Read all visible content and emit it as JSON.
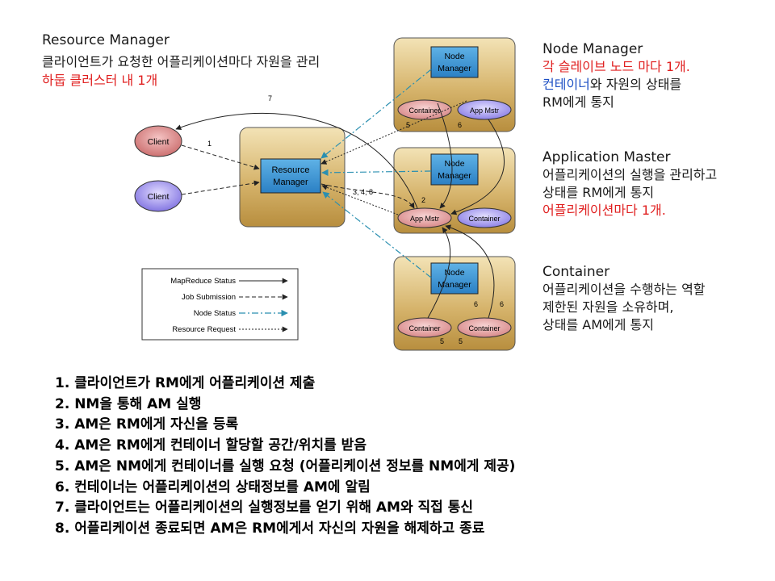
{
  "rm_desc": {
    "title": "Resource Manager",
    "line1": "클라이언트가 요청한 어플리케이션마다  자원을 관리",
    "line2": "하둡 클러스터 내 1개"
  },
  "nm_desc": {
    "title": "Node Manager",
    "line1": "각 슬레이브 노드 마다 1개.",
    "line2_blue": "컨테이너",
    "line2_rest": "와 자원의 상태를",
    "line3": "RM에게 통지"
  },
  "am_desc": {
    "title": "Application Master",
    "line1": "어플리케이션의 실행을 관리하고",
    "line2": "상태를 RM에게 통지",
    "line3": "어플리케이션마다 1개."
  },
  "container_desc": {
    "title": "Container",
    "line1": "어플리케이션을 수행하는 역할",
    "line2": "제한된 자원을 소유하며,",
    "line3": "상태를 AM에게 통지"
  },
  "diagram": {
    "client_label": "Client",
    "rm_label_1": "Resource",
    "rm_label_2": "Manager",
    "nm_label_1": "Node",
    "nm_label_2": "Manager",
    "container_label": "Container",
    "appmstr_label": "App Mstr",
    "num_7": "7",
    "num_1": "1",
    "num_2": "2",
    "num_348": "3, 4, 8",
    "num_5": "5",
    "num_6": "6",
    "legend": {
      "mapreduce": "MapReduce Status",
      "job": "Job Submission",
      "node": "Node Status",
      "resource": "Resource Request"
    }
  },
  "steps": [
    "1. 클라이언트가 RM에게 어플리케이션 제출",
    "2. NM을 통해 AM 실행",
    "3. AM은 RM에게 자신을 등록",
    "4. AM은 RM에게 컨테이너 할당할 공간/위치를 받음",
    "5. AM은 NM에게 컨테이너를 실행 요청 (어플리케이션 정보를 NM에게 제공)",
    "6. 컨테이너는 어플리케이션의 상태정보를 AM에 알림",
    "7. 클라이언트는 어플리케이션의 실행정보를 얻기 위해 AM와 직접 통신",
    "8. 어플리케이션 종료되면 AM은 RM에게서 자신의 자원을 해제하고 종료"
  ]
}
